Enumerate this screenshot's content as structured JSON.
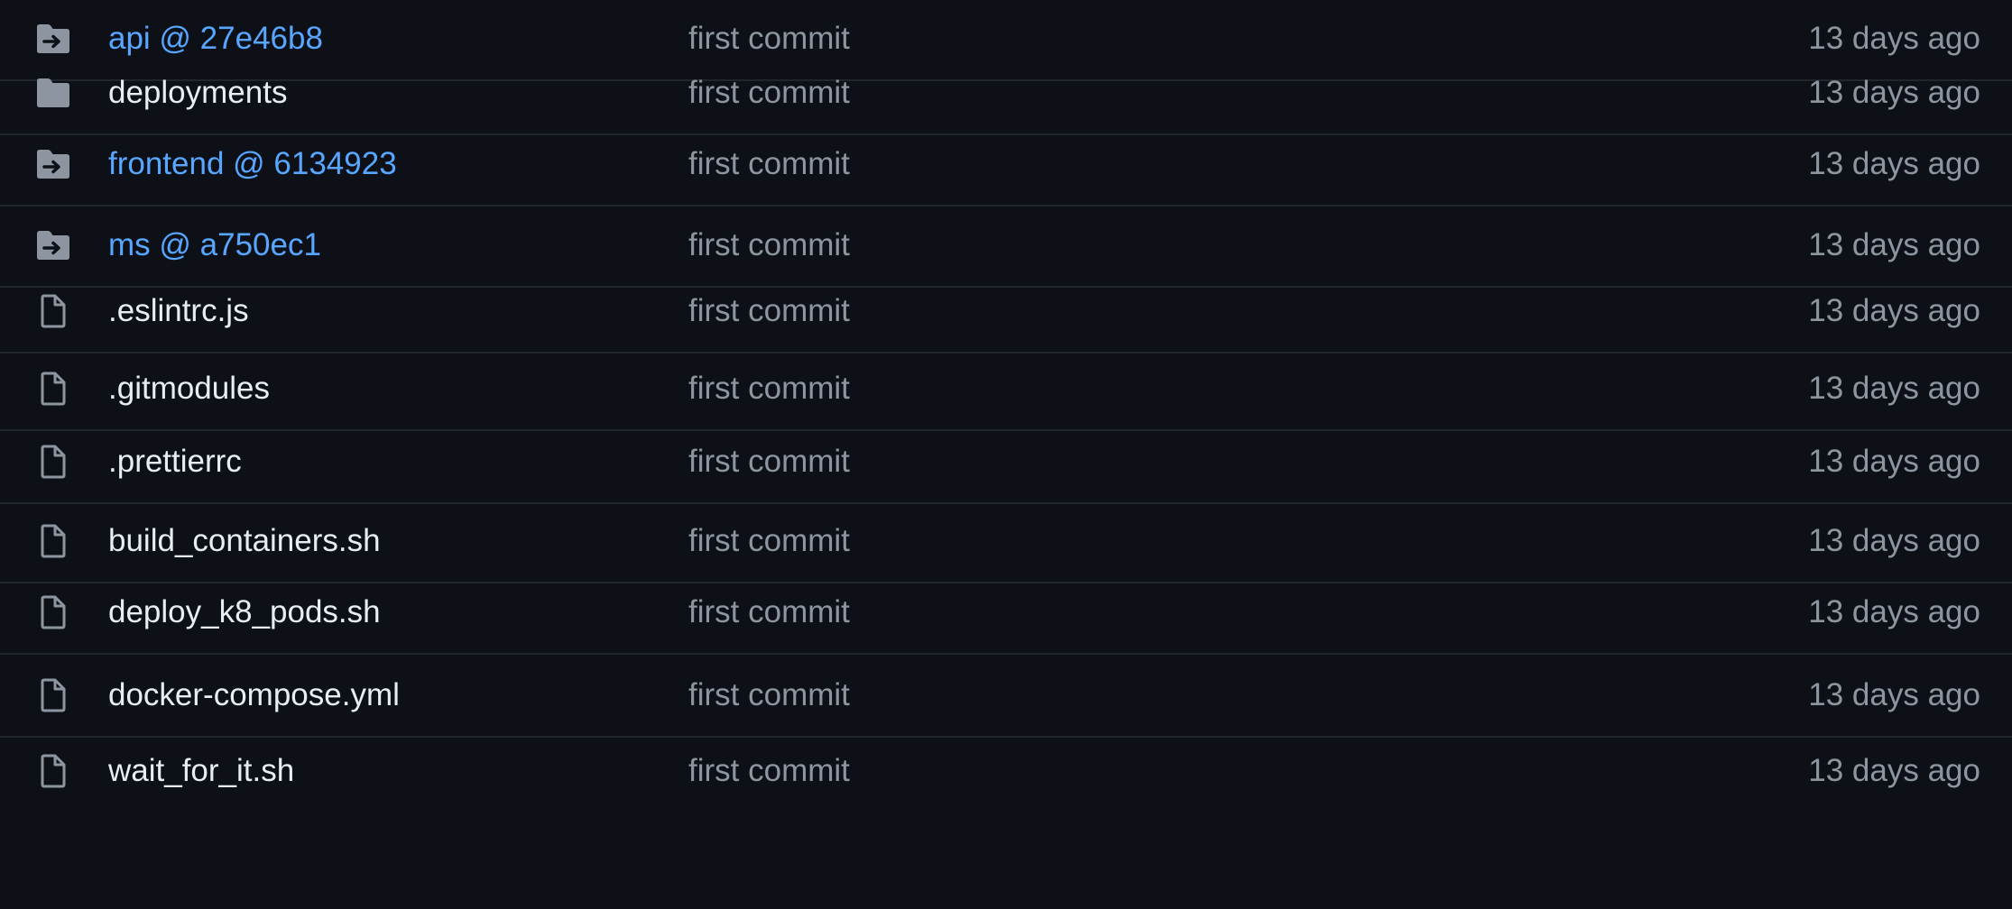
{
  "colors": {
    "background": "#0d1117",
    "divider": "#21262d",
    "file_name": "#e6edf3",
    "submodule_link": "#58a6ff",
    "muted_text": "#8d96a0",
    "icon": "#8d96a0"
  },
  "files": [
    {
      "name": "api @ 27e46b8",
      "type": "submodule",
      "icon": "submodule-folder-icon",
      "commit": "first commit",
      "age": "13 days ago"
    },
    {
      "name": "deployments",
      "type": "directory",
      "icon": "folder-icon",
      "commit": "first commit",
      "age": "13 days ago"
    },
    {
      "name": "frontend @ 6134923",
      "type": "submodule",
      "icon": "submodule-folder-icon",
      "commit": "first commit",
      "age": "13 days ago"
    },
    {
      "name": "ms @ a750ec1",
      "type": "submodule",
      "icon": "submodule-folder-icon",
      "commit": "first commit",
      "age": "13 days ago"
    },
    {
      "name": ".eslintrc.js",
      "type": "file",
      "icon": "file-icon",
      "commit": "first commit",
      "age": "13 days ago"
    },
    {
      "name": ".gitmodules",
      "type": "file",
      "icon": "file-icon",
      "commit": "first commit",
      "age": "13 days ago"
    },
    {
      "name": ".prettierrc",
      "type": "file",
      "icon": "file-icon",
      "commit": "first commit",
      "age": "13 days ago"
    },
    {
      "name": "build_containers.sh",
      "type": "file",
      "icon": "file-icon",
      "commit": "first commit",
      "age": "13 days ago"
    },
    {
      "name": "deploy_k8_pods.sh",
      "type": "file",
      "icon": "file-icon",
      "commit": "first commit",
      "age": "13 days ago"
    },
    {
      "name": "docker-compose.yml",
      "type": "file",
      "icon": "file-icon",
      "commit": "first commit",
      "age": "13 days ago"
    },
    {
      "name": "wait_for_it.sh",
      "type": "file",
      "icon": "file-icon",
      "commit": "first commit",
      "age": "13 days ago"
    }
  ]
}
